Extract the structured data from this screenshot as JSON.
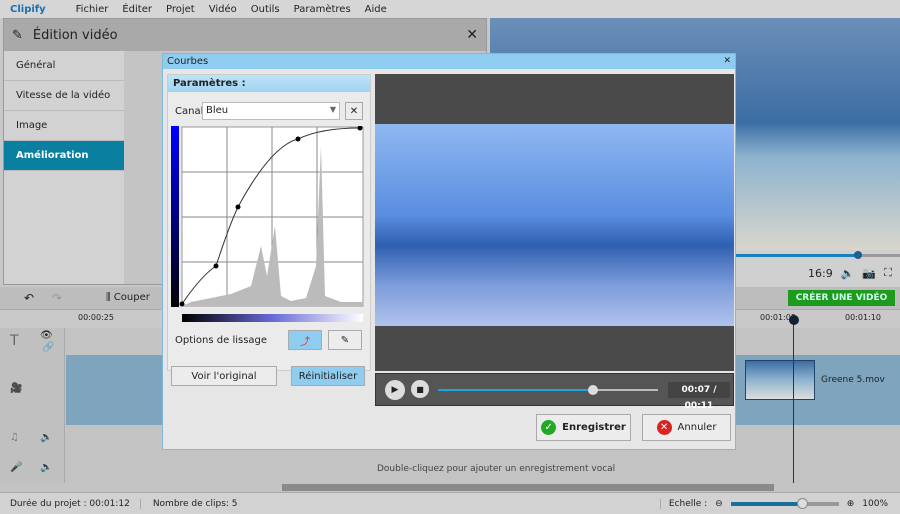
{
  "app": {
    "name": "Clipify",
    "menu": [
      "Fichier",
      "Éditer",
      "Projet",
      "Vidéo",
      "Outils",
      "Paramètres",
      "Aide"
    ]
  },
  "edit_panel": {
    "title": "Édition vidéo",
    "items": [
      "Général",
      "Vitesse de la vidéo",
      "Image",
      "Amélioration"
    ],
    "selected": "Amélioration"
  },
  "preview": {
    "aspect": "16:9",
    "create_button": "CRÉER UNE VIDÉO",
    "seek_fraction": 0.9
  },
  "timeline": {
    "undo": "undo",
    "cut_label": "Couper",
    "ruler": [
      "00:00:25",
      "00:01:05",
      "00:01:10"
    ],
    "clip_name": "Greene 5.mov",
    "voice_hint": "Double-cliquez pour ajouter un enregistrement vocal"
  },
  "status": {
    "duration": "Durée du projet :  00:01:12",
    "clips": "Nombre de clips: 5",
    "scale_label": "Echelle :",
    "zoom": "100%",
    "scale_fraction": 0.7
  },
  "dialog": {
    "title": "Courbes",
    "params_header": "Paramètres :",
    "channel_label": "Canal",
    "channel_value": "Bleu",
    "smoothing_label": "Options de lissage",
    "view_original": "Voir l'original",
    "reset": "Réinitialiser",
    "time": "00:07 / 00:11",
    "progress_fraction": 0.7,
    "save": "Enregistrer",
    "cancel": "Annuler"
  },
  "colors": {
    "accent": "#0a7fa0",
    "create": "#1e9a1e",
    "dialog_title": "#8fcdf0"
  }
}
